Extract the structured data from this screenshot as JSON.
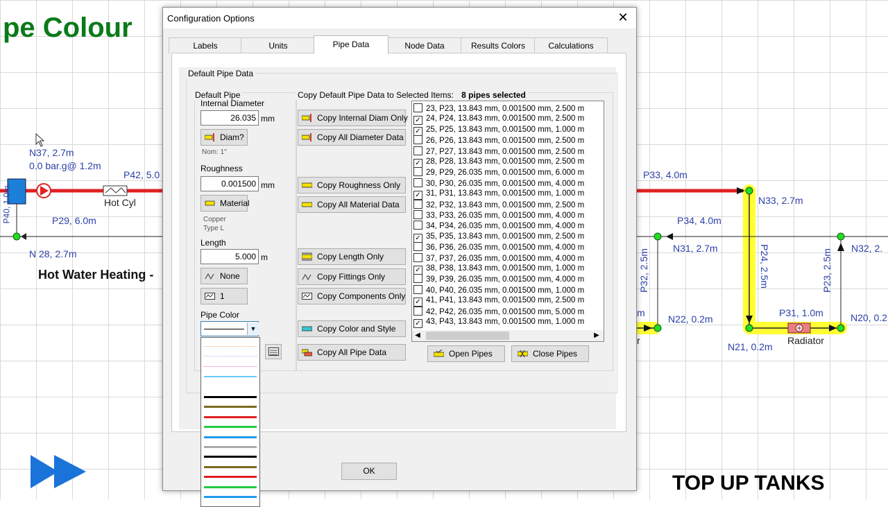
{
  "background": {
    "title_fragment": "pe Colour",
    "subtitle": "Hot Water Heating -",
    "top_up": "TOP UP TANKS",
    "labels": {
      "n37": "N37, 2.7m",
      "n37_pressure": "0.0 bar.g@ 1.2m",
      "p42": "P42, 5.0",
      "hot_cyl": "Hot Cyl",
      "p29": "P29, 6.0m",
      "n28": "N 28, 2.7m",
      "p40": "P40, 1.0m",
      "p33": "P33, 4.0m",
      "n33": "N33, 2.7m",
      "p34": "P34, 4.0m",
      "n31": "N31, 2.7m",
      "n32": "N32, 2.",
      "p24": "P24, 2.5m",
      "p32": "P32, 2.5m",
      "p23": "P23, 2.5m",
      "p31": "P31, 1.0m",
      "n22": "N22, 0.2m",
      "n20": "N20, 0.2",
      "n21": "N21, 0.2m",
      "radiator": "Radiator",
      "m_frag": "m",
      "r_frag": "r"
    }
  },
  "dialog": {
    "title": "Configuration Options",
    "close_label": "✕",
    "tabs": [
      "Labels",
      "Units",
      "Pipe Data",
      "Node Data",
      "Results Colors",
      "Calculations"
    ],
    "active_tab": "Pipe Data",
    "default_pipe_data_label": "Default Pipe Data",
    "default_pipe_label": "Default Pipe",
    "internal_diameter_label": "Internal Diameter",
    "internal_diameter_value": "26.035",
    "mm_unit": "mm",
    "diam_button": "Diam?",
    "nom_note": "Nom: 1\"",
    "roughness_label": "Roughness",
    "roughness_value": "0.001500",
    "material_button": "Material",
    "material_note_1": "Copper",
    "material_note_2": "Type L",
    "length_label": "Length",
    "length_value": "5.000",
    "m_unit": "m",
    "fittings_button": "None",
    "components_button": "1",
    "pipe_color_label": "Pipe Color",
    "copy_header": "Copy Default Pipe Data to Selected Items:",
    "selected_count": "8 pipes selected",
    "copy_buttons": {
      "internal_diam": "Copy Internal Diam Only",
      "all_diameter": "Copy All Diameter Data",
      "roughness": "Copy Roughness Only",
      "all_material": "Copy All Material Data",
      "length": "Copy Length Only",
      "fittings": "Copy Fittings Only",
      "components": "Copy Components Only",
      "color_style": "Copy Color and Style",
      "all_pipe": "Copy All Pipe Data"
    },
    "open_pipes": "Open Pipes",
    "close_pipes": "Close Pipes",
    "ok": "OK",
    "pipes": [
      {
        "text": "23, P23, 13.843 mm, 0.001500 mm, 2.500 m",
        "checked": false
      },
      {
        "text": "24, P24, 13.843 mm, 0.001500 mm, 2.500 m",
        "checked": true
      },
      {
        "text": "25, P25, 13.843 mm, 0.001500 mm, 1.000 m",
        "checked": true
      },
      {
        "text": "26, P26, 13.843 mm, 0.001500 mm, 2.500 m",
        "checked": false
      },
      {
        "text": "27, P27, 13.843 mm, 0.001500 mm, 2.500 m",
        "checked": false
      },
      {
        "text": "28, P28, 13.843 mm, 0.001500 mm, 2.500 m",
        "checked": true
      },
      {
        "text": "29, P29, 26.035 mm, 0.001500 mm, 6.000 m",
        "checked": false
      },
      {
        "text": "30, P30, 26.035 mm, 0.001500 mm, 4.000 m",
        "checked": false
      },
      {
        "text": "31, P31, 13.843 mm, 0.001500 mm, 1.000 m",
        "checked": true
      },
      {
        "text": "32, P32, 13.843 mm, 0.001500 mm, 2.500 m",
        "checked": false
      },
      {
        "text": "33, P33, 26.035 mm, 0.001500 mm, 4.000 m",
        "checked": false
      },
      {
        "text": "34, P34, 26.035 mm, 0.001500 mm, 4.000 m",
        "checked": false
      },
      {
        "text": "35, P35, 13.843 mm, 0.001500 mm, 2.500 m",
        "checked": true
      },
      {
        "text": "36, P36, 26.035 mm, 0.001500 mm, 4.000 m",
        "checked": false
      },
      {
        "text": "37, P37, 26.035 mm, 0.001500 mm, 4.000 m",
        "checked": false
      },
      {
        "text": "38, P38, 13.843 mm, 0.001500 mm, 1.000 m",
        "checked": true
      },
      {
        "text": "39, P39, 26.035 mm, 0.001500 mm, 4.000 m",
        "checked": false
      },
      {
        "text": "40, P40, 26.035 mm, 0.001500 mm, 1.000 m",
        "checked": false
      },
      {
        "text": "41, P41, 13.843 mm, 0.001500 mm, 2.500 m",
        "checked": true
      },
      {
        "text": "42, P42, 26.035 mm, 0.001500 mm, 5.000 m",
        "checked": false
      },
      {
        "text": "43, P43, 13.843 mm, 0.001500 mm, 1.000 m",
        "checked": true
      }
    ],
    "color_swatches": [
      "#f4b183",
      "#c9a7f0",
      "#ff66cc",
      "#66ccff",
      "#ffffff",
      "#000000",
      "#7a6a1c",
      "#e02020",
      "#22cc44",
      "#2299ee",
      "#aaaaaa",
      "#000000",
      "#7a6a1c",
      "#e02020",
      "#22cc44",
      "#2299ee"
    ]
  }
}
